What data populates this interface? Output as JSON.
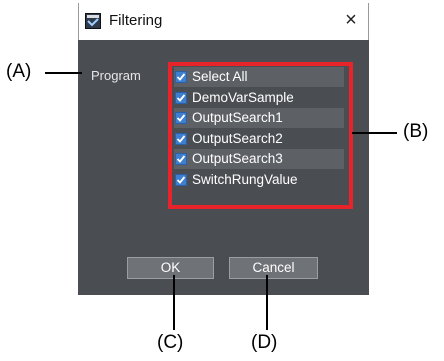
{
  "dialog": {
    "title": "Filtering",
    "close_glyph": "×",
    "program_label": "Program",
    "items": [
      {
        "label": "Select All",
        "checked": true
      },
      {
        "label": "DemoVarSample",
        "checked": true
      },
      {
        "label": "OutputSearch1",
        "checked": true
      },
      {
        "label": "OutputSearch2",
        "checked": true
      },
      {
        "label": "OutputSearch3",
        "checked": true
      },
      {
        "label": "SwitchRungValue",
        "checked": true
      }
    ],
    "ok_label": "OK",
    "cancel_label": "Cancel"
  },
  "annotations": {
    "a": "(A)",
    "b": "(B)",
    "c": "(C)",
    "d": "(D)"
  },
  "colors": {
    "dialog_bg": "#4a4d52",
    "highlight": "#e8232a",
    "checkbox": "#3f7fd0"
  },
  "icons": {
    "title": "app-window-icon",
    "close": "close-icon",
    "check": "checkmark-icon"
  }
}
